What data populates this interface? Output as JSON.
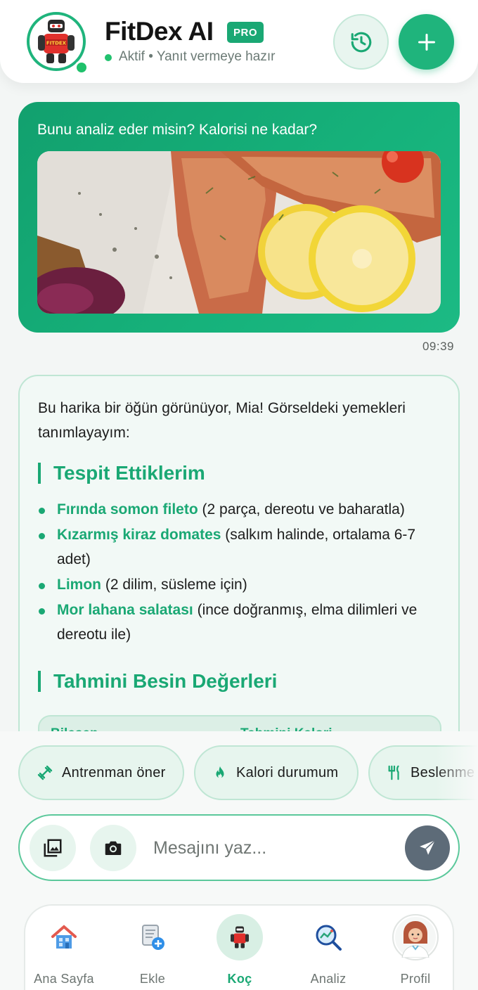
{
  "header": {
    "title": "FitDex AI",
    "badge": "PRO",
    "status_text": "Aktif • Yanıt vermeye hazır",
    "avatar_text": "FITDEX"
  },
  "chat": {
    "user_message": {
      "text": "Bunu analiz eder misin? Kalorisi ne kadar?",
      "time": "09:39"
    },
    "ai_message": {
      "intro": "Bu harika bir öğün görünüyor, Mia! Görseldeki yemekleri tanımlayayım:",
      "section1_title": "Tespit Ettiklerim",
      "items": [
        {
          "bold": "Fırında somon fileto",
          "rest": " (2 parça, dereotu ve baharatla)"
        },
        {
          "bold": "Kızarmış kiraz domates",
          "rest": " (salkım halinde, ortalama 6-7 adet)"
        },
        {
          "bold": "Limon",
          "rest": " (2 dilim, süsleme için)"
        },
        {
          "bold": "Mor lahana salatası",
          "rest": " (ince doğranmış, elma dilimleri ve dereotu ile)"
        }
      ],
      "section2_title": "Tahmini Besin Değerleri",
      "table_headers": [
        "Bileşen",
        "Tahmini Kalori"
      ]
    }
  },
  "quick_actions": [
    {
      "label": "Antrenman öner",
      "icon": "dumbbell-icon"
    },
    {
      "label": "Kalori durumum",
      "icon": "flame-icon"
    },
    {
      "label": "Beslenme",
      "icon": "fork-knife-icon"
    }
  ],
  "composer": {
    "placeholder": "Mesajını yaz..."
  },
  "tabs": [
    {
      "label": "Ana Sayfa",
      "icon": "home-icon",
      "active": false
    },
    {
      "label": "Ekle",
      "icon": "add-document-icon",
      "active": false
    },
    {
      "label": "Koç",
      "icon": "robot-coach-icon",
      "active": true
    },
    {
      "label": "Analiz",
      "icon": "analytics-icon",
      "active": false
    },
    {
      "label": "Profil",
      "icon": "profile-avatar-icon",
      "active": false
    }
  ],
  "colors": {
    "brand_green": "#1aa874",
    "send_button": "#5d6b78"
  }
}
